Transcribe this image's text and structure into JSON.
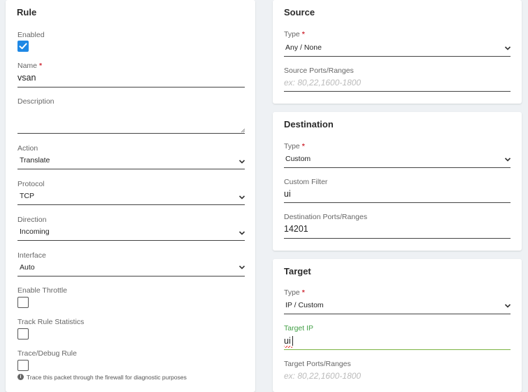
{
  "rule": {
    "title": "Rule",
    "enabled_label": "Enabled",
    "enabled_checked": true,
    "name_label": "Name",
    "required_mark": "*",
    "name_value": "vsan",
    "description_label": "Description",
    "description_value": "",
    "action_label": "Action",
    "action_value": "Translate",
    "protocol_label": "Protocol",
    "protocol_value": "TCP",
    "direction_label": "Direction",
    "direction_value": "Incoming",
    "interface_label": "Interface",
    "interface_value": "Auto",
    "throttle_label": "Enable Throttle",
    "throttle_checked": false,
    "stats_label": "Track Rule Statistics",
    "stats_checked": false,
    "trace_label": "Trace/Debug Rule",
    "trace_checked": false,
    "trace_hint": "Trace this packet through the firewall for diagnostic purposes"
  },
  "source": {
    "title": "Source",
    "type_label": "Type",
    "type_value": "Any / None",
    "ports_label": "Source Ports/Ranges",
    "ports_placeholder": "ex: 80,22,1600-1800"
  },
  "destination": {
    "title": "Destination",
    "type_label": "Type",
    "type_value": "Custom",
    "filter_label": "Custom Filter",
    "filter_value": "ui",
    "ports_label": "Destination Ports/Ranges",
    "ports_value": "14201"
  },
  "target": {
    "title": "Target",
    "type_label": "Type",
    "type_value": "IP / Custom",
    "ip_label": "Target IP",
    "ip_value": "ui",
    "ports_label": "Target Ports/Ranges",
    "ports_placeholder": "ex: 80,22,1600-1800"
  },
  "icons": {
    "chevron": "chevron-down-icon",
    "check": "checkmark-icon",
    "info": "info-icon"
  },
  "colors": {
    "checkbox_accent": "#1e88e5",
    "required": "#d0323c",
    "focus_label": "#43a047",
    "focus_line": "#7cb342",
    "spell_error": "#e53935"
  }
}
